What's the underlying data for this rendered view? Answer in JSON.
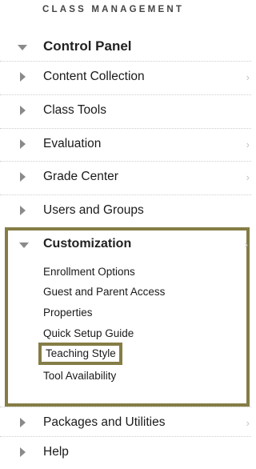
{
  "section_title": "CLASS MANAGEMENT",
  "control_panel": {
    "label": "Control Panel"
  },
  "nav_items": [
    {
      "label": "Content Collection",
      "has_chevron": true
    },
    {
      "label": "Class Tools",
      "has_chevron": false
    },
    {
      "label": "Evaluation",
      "has_chevron": true
    },
    {
      "label": "Grade Center",
      "has_chevron": true
    },
    {
      "label": "Users and Groups",
      "has_chevron": false
    }
  ],
  "customization": {
    "label": "Customization",
    "items": [
      {
        "label": "Enrollment Options"
      },
      {
        "label": "Guest and Parent Access"
      },
      {
        "label": "Properties"
      },
      {
        "label": "Quick Setup Guide"
      },
      {
        "label": "Teaching Style"
      },
      {
        "label": "Tool Availability"
      }
    ]
  },
  "bottom_items": [
    {
      "label": "Packages and Utilities",
      "has_chevron": true
    },
    {
      "label": "Help",
      "has_chevron": false
    }
  ],
  "chevron_glyph": "›",
  "colors": {
    "highlight_border": "#857d46",
    "arrow": "#8a8a8a"
  }
}
